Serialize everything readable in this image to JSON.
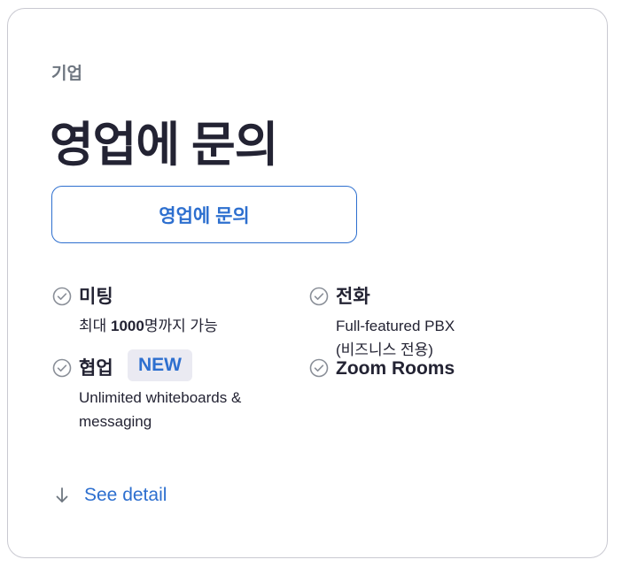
{
  "card": {
    "eyebrow": "기업",
    "title": "영업에 문의",
    "cta_label": "영업에 문의"
  },
  "features": {
    "meetings": {
      "title": "미팅",
      "desc_prefix": "최대 ",
      "desc_bold": "1000",
      "desc_suffix": "명까지 가능"
    },
    "phone": {
      "title": "전화",
      "desc_line1": "Full-featured PBX",
      "desc_line2": "(비즈니스 전용)"
    },
    "whiteboard": {
      "title": "협업",
      "badge": "NEW",
      "desc_line1": "Unlimited whiteboards &",
      "desc_line2": "messaging"
    },
    "rooms": {
      "title": "Zoom Rooms"
    }
  },
  "see_detail": {
    "label": "See detail",
    "icon": "arrow-down-icon"
  },
  "colors": {
    "accent": "#2d6fcf",
    "text": "#232333",
    "muted": "#6e7680",
    "badge_bg": "#eaeaf2",
    "border": "#c9c9d1"
  }
}
